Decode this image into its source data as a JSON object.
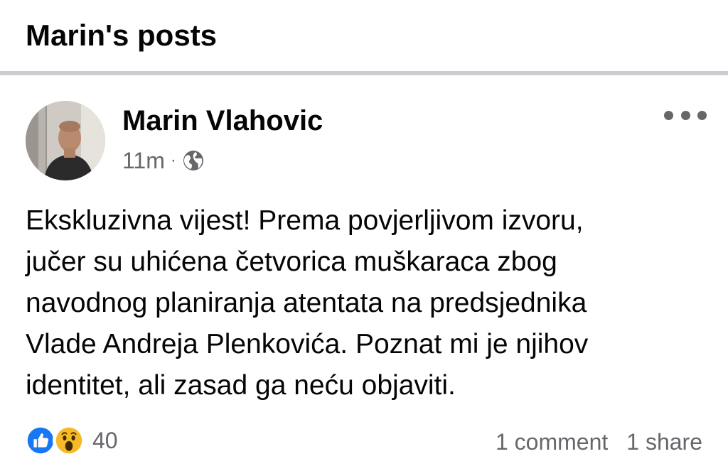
{
  "header": {
    "title": "Marin's posts"
  },
  "post": {
    "author": "Marin Vlahovic",
    "time": "11m",
    "separator": "·",
    "audience_icon": "globe-icon",
    "more_icon": "more-options-icon",
    "text_lines": [
      "Ekskluzivna vijest! Prema povjerljivom izvoru,",
      "jučer su uhićena četvorica muškaraca zbog",
      "navodnog planiranja atentata na predsjednika",
      "Vlade Andreja Plenkovića. Poznat mi je njihov",
      "identitet, ali zasad ga neću objaviti."
    ],
    "reactions": {
      "icons": [
        "like-icon",
        "wow-icon"
      ],
      "count": "40"
    },
    "comments": "1 comment",
    "shares": "1 share"
  },
  "colors": {
    "like_blue": "#1877f2",
    "wow_yellow": "#f7b928",
    "secondary_text": "#65676b",
    "divider": "#c9ccd1"
  }
}
